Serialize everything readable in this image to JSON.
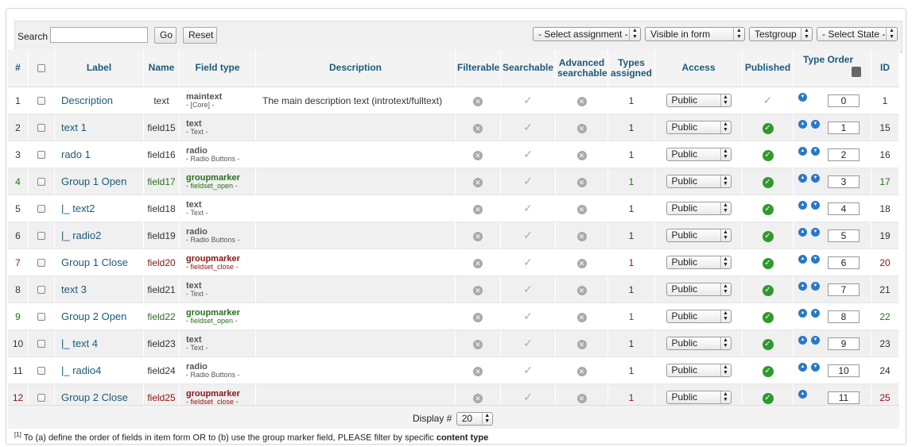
{
  "filter": {
    "search_label": "Search",
    "search_value": "",
    "go_label": "Go",
    "reset_label": "Reset",
    "selects": [
      "- Select assignment -",
      "Visible in form",
      "Testgroup",
      "- Select State -"
    ]
  },
  "columns": [
    "#",
    "",
    "Label",
    "Name",
    "Field type",
    "Description",
    "Filterable",
    "Searchable",
    "Advanced searchable",
    "Types assigned",
    "Access",
    "Published",
    "Type Order",
    "ID"
  ],
  "rows": [
    {
      "num": "1",
      "label": "Description",
      "name": "text",
      "ftype": "maintext",
      "fsub": "- [Core] -",
      "desc": "The main description text (introtext/fulltext)",
      "types": "1",
      "access": "Public",
      "published": "gray",
      "order": "0",
      "id": "1",
      "color": "normal",
      "arrows": "down"
    },
    {
      "num": "2",
      "label": "text 1",
      "name": "field15",
      "ftype": "text",
      "fsub": "- Text -",
      "desc": "",
      "types": "1",
      "access": "Public",
      "published": "green",
      "order": "1",
      "id": "15",
      "color": "normal",
      "arrows": "both"
    },
    {
      "num": "3",
      "label": "rado 1",
      "name": "field16",
      "ftype": "radio",
      "fsub": "- Radio Buttons -",
      "desc": "",
      "types": "1",
      "access": "Public",
      "published": "green",
      "order": "2",
      "id": "16",
      "color": "normal",
      "arrows": "both"
    },
    {
      "num": "4",
      "label": "Group 1 Open",
      "name": "field17",
      "ftype": "groupmarker",
      "fsub": "- fieldset_open -",
      "desc": "",
      "types": "1",
      "access": "Public",
      "published": "green",
      "order": "3",
      "id": "17",
      "color": "green",
      "arrows": "both"
    },
    {
      "num": "5",
      "label": "|_ text2",
      "name": "field18",
      "ftype": "text",
      "fsub": "- Text -",
      "desc": "",
      "types": "1",
      "access": "Public",
      "published": "green",
      "order": "4",
      "id": "18",
      "color": "normal",
      "arrows": "both"
    },
    {
      "num": "6",
      "label": "|_ radio2",
      "name": "field19",
      "ftype": "radio",
      "fsub": "- Radio Buttons -",
      "desc": "",
      "types": "1",
      "access": "Public",
      "published": "green",
      "order": "5",
      "id": "19",
      "color": "normal",
      "arrows": "both"
    },
    {
      "num": "7",
      "label": "Group 1 Close",
      "name": "field20",
      "ftype": "groupmarker",
      "fsub": "- fieldset_close -",
      "desc": "",
      "types": "1",
      "access": "Public",
      "published": "green",
      "order": "6",
      "id": "20",
      "color": "red",
      "arrows": "both"
    },
    {
      "num": "8",
      "label": "text 3",
      "name": "field21",
      "ftype": "text",
      "fsub": "- Text -",
      "desc": "",
      "types": "1",
      "access": "Public",
      "published": "green",
      "order": "7",
      "id": "21",
      "color": "normal",
      "arrows": "both"
    },
    {
      "num": "9",
      "label": "Group 2 Open",
      "name": "field22",
      "ftype": "groupmarker",
      "fsub": "- fieldset_open -",
      "desc": "",
      "types": "1",
      "access": "Public",
      "published": "green",
      "order": "8",
      "id": "22",
      "color": "green",
      "arrows": "both"
    },
    {
      "num": "10",
      "label": "|_ text 4",
      "name": "field23",
      "ftype": "text",
      "fsub": "- Text -",
      "desc": "",
      "types": "1",
      "access": "Public",
      "published": "green",
      "order": "9",
      "id": "23",
      "color": "normal",
      "arrows": "both"
    },
    {
      "num": "11",
      "label": "|_ radio4",
      "name": "field24",
      "ftype": "radio",
      "fsub": "- Radio Buttons -",
      "desc": "",
      "types": "1",
      "access": "Public",
      "published": "green",
      "order": "10",
      "id": "24",
      "color": "normal",
      "arrows": "both"
    },
    {
      "num": "12",
      "label": "Group 2 Close",
      "name": "field25",
      "ftype": "groupmarker",
      "fsub": "- fieldset_close -",
      "desc": "",
      "types": "1",
      "access": "Public",
      "published": "green",
      "order": "11",
      "id": "25",
      "color": "red",
      "arrows": "up"
    }
  ],
  "footer": {
    "display_label": "Display #",
    "display_value": "20"
  },
  "note": {
    "ref": "[1]",
    "text": " To (a) define the order of fields in item form OR to (b) use the group marker field, PLEASE filter by specific ",
    "bold": "content type"
  }
}
